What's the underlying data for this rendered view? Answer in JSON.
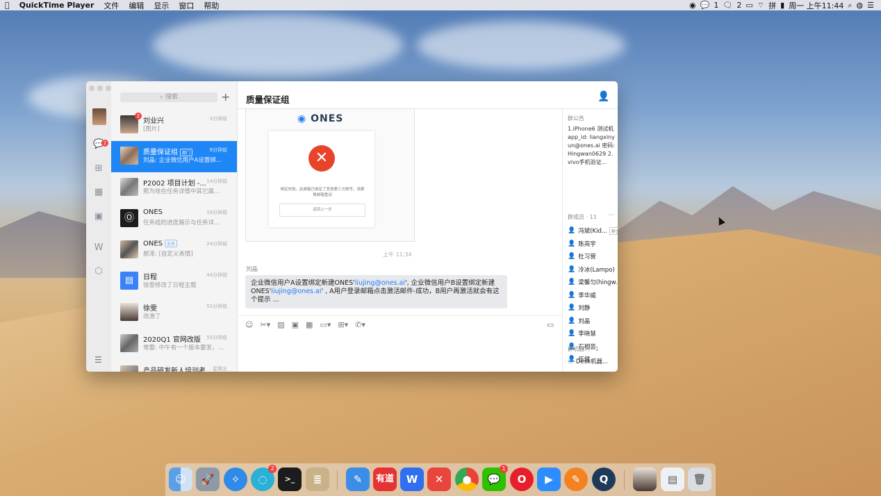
{
  "menubar": {
    "app": "QuickTime Player",
    "menus": [
      "文件",
      "编辑",
      "显示",
      "窗口",
      "帮助"
    ],
    "wechat_count": "1",
    "msg_count": "2",
    "ime": "拼",
    "clock": "周一 上午11:44"
  },
  "sidebar": {
    "messages_badge": "2"
  },
  "list": {
    "search_placeholder": "搜索",
    "conversations": [
      {
        "name": "刘业兴",
        "preview": "[图片]",
        "time": "3分钟前",
        "badge": "2"
      },
      {
        "name": "质量保证组",
        "tag": "部门",
        "preview": "刘晶: 企业微信用户A设置绑...",
        "time": "9分钟前"
      },
      {
        "name": "P2002 项目计划 -...",
        "preview": "那为啥在任务详情中其它属性...",
        "time": "14分钟前"
      },
      {
        "name": "ONES",
        "preview": "任务组的进度展示与任务详情...",
        "time": "19分钟前"
      },
      {
        "name": "ONES",
        "tag": "全员",
        "preview": "郝泽: [自定义表情]",
        "time": "24分钟前"
      },
      {
        "name": "日程",
        "preview": "徐雯修改了日程主题",
        "time": "44分钟前"
      },
      {
        "name": "徐雯",
        "preview": "改滑了",
        "time": "52分钟前"
      },
      {
        "name": "2020Q1 官网改版",
        "preview": "常蕾: 中午有一个版本要发，O...",
        "time": "55分钟前"
      },
      {
        "name": "产品研发新人培训考...",
        "preview": "",
        "time": "星期五"
      }
    ]
  },
  "chat": {
    "title": "质量保证组",
    "image_card": {
      "brand": "ONES",
      "message": "绑定失败。此邮箱已绑定了其他第三方账号，请更换邮箱重试",
      "button": "返回上一步"
    },
    "timestamp": "上午 11:34",
    "sender": "刘晶",
    "bubble": {
      "part1": "企业微信用户A设置绑定新建ONES'",
      "link1": "liujing@ones.ai",
      "part2": "', 企业微信用户B设置绑定新建ONES'",
      "link2": "liujing@ones.ai",
      "part3": "' , A用户登录邮箱点击激活邮件-成功，B用户再激活就会有这个提示 ..."
    }
  },
  "sidepanel": {
    "notice_label": "群公告",
    "notice_text": "1.iPhone6 测试机 app_id: liangxinyun@ones.ai 密码: Hingwan0629 2.vivo手机验证...",
    "members_label": "群成员 · 11",
    "owner_tag": "群主",
    "members": [
      "冯斌(Kid...",
      "陈亮宇",
      "杜习营",
      "冷冰(Lampo)",
      "梁馨匀(hingw...",
      "李华威",
      "刘静",
      "刘晶",
      "李晓慧",
      "石相芸",
      "伍健"
    ],
    "bots_label": "群机器人 · 1",
    "bot": "Desk机器..."
  },
  "dock": {
    "youdao_label": "有道",
    "messages_badge": "2",
    "wechat_badge": "1"
  }
}
